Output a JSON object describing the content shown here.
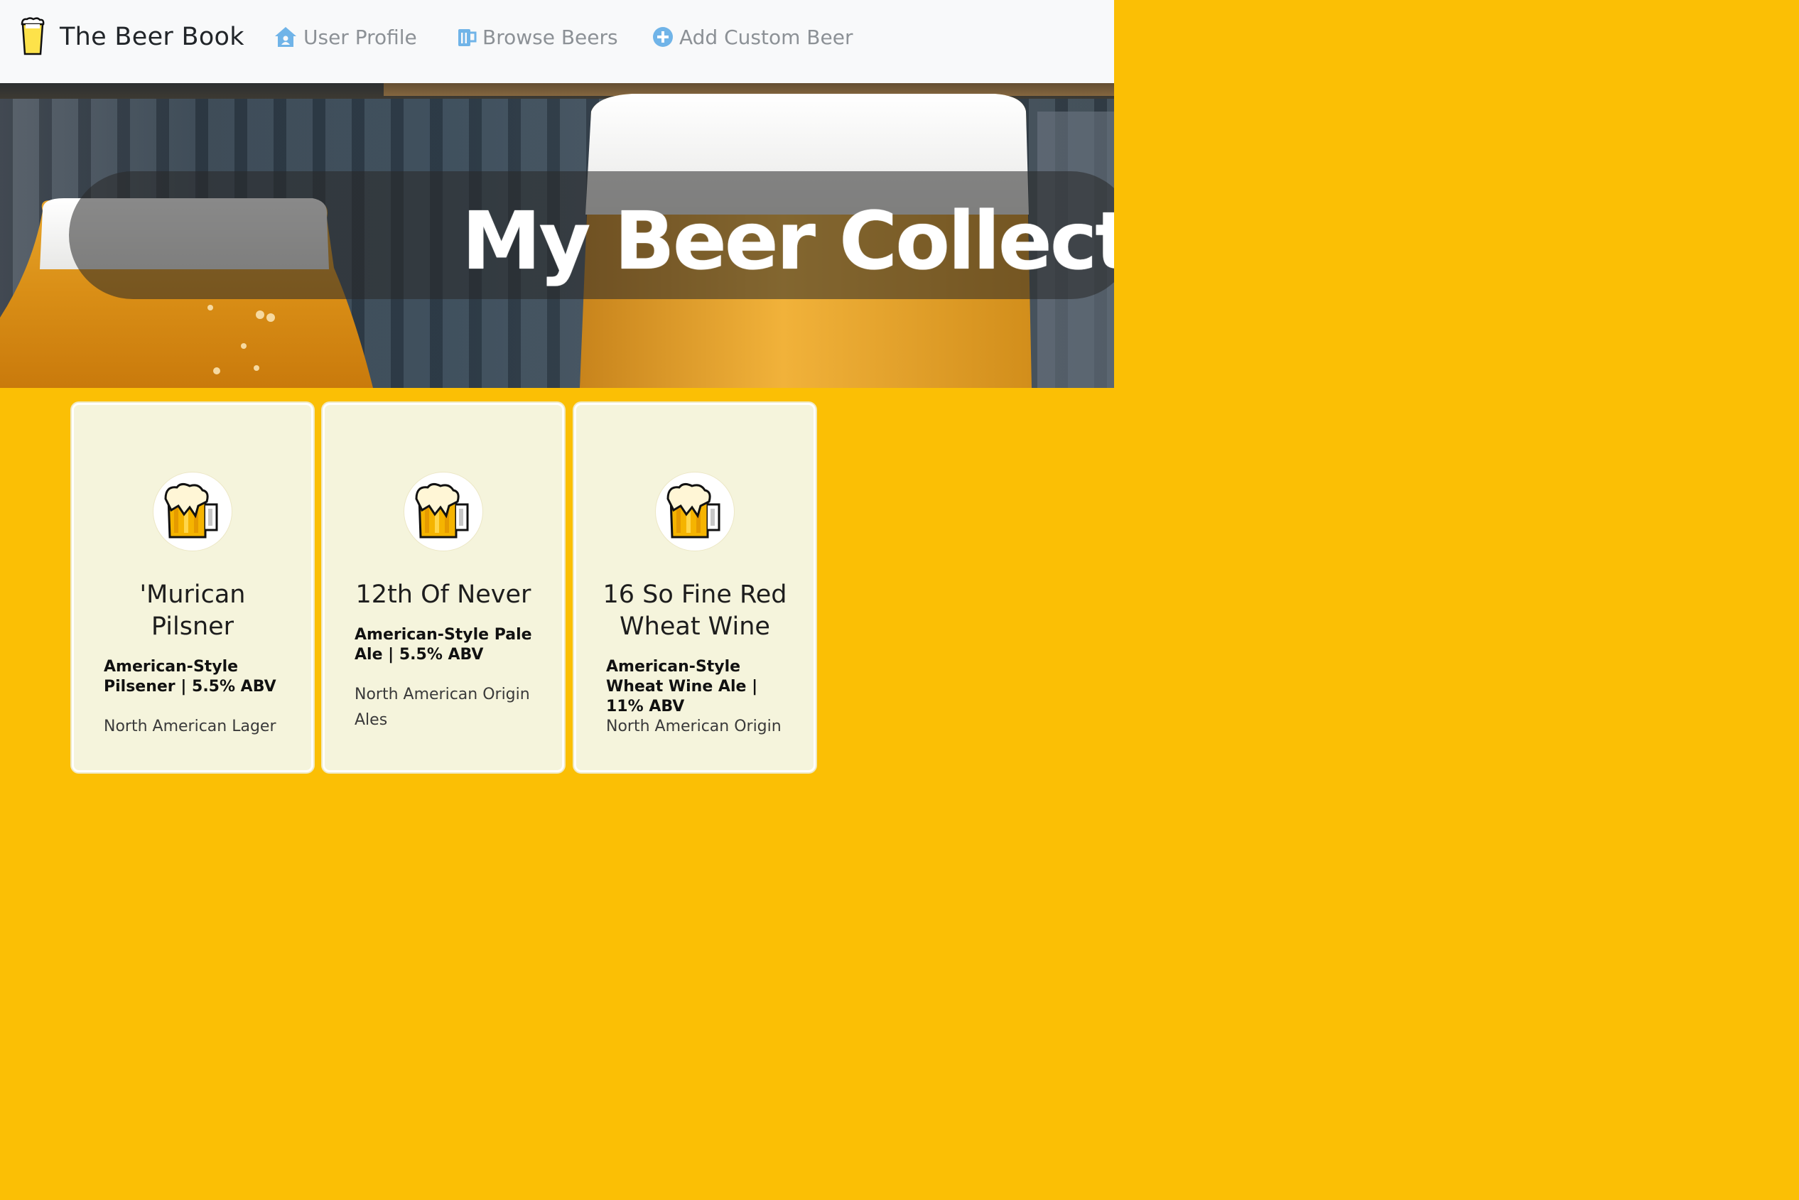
{
  "navbar": {
    "brand": "The Beer Book",
    "items": [
      {
        "label": "User Profile",
        "icon": "home-icon"
      },
      {
        "label": "Browse Beers",
        "icon": "beer-mug-icon"
      },
      {
        "label": "Add Custom Beer",
        "icon": "plus-circle-icon"
      }
    ],
    "icon_color": "#70b4e8",
    "text_color": "#8c9196"
  },
  "hero": {
    "title": "My Beer Collection"
  },
  "cards": [
    {
      "name": "'Murican Pilsner",
      "style": "American-Style Pilsener | 5.5% ABV",
      "origin": "North American Lager",
      "icon": "beer-mug-icon"
    },
    {
      "name": "12th Of Never",
      "style": "American-Style Pale Ale | 5.5% ABV",
      "origin": "North American Origin Ales",
      "icon": "beer-mug-icon"
    },
    {
      "name": "16 So Fine Red Wheat Wine",
      "style": "American-Style Wheat Wine Ale | 11% ABV",
      "origin": "North American Origin",
      "icon": "beer-mug-icon"
    }
  ],
  "colors": {
    "page_background": "#fbbf05",
    "card_background": "#f5f4dc",
    "navbar_background": "#f8f9fa"
  }
}
